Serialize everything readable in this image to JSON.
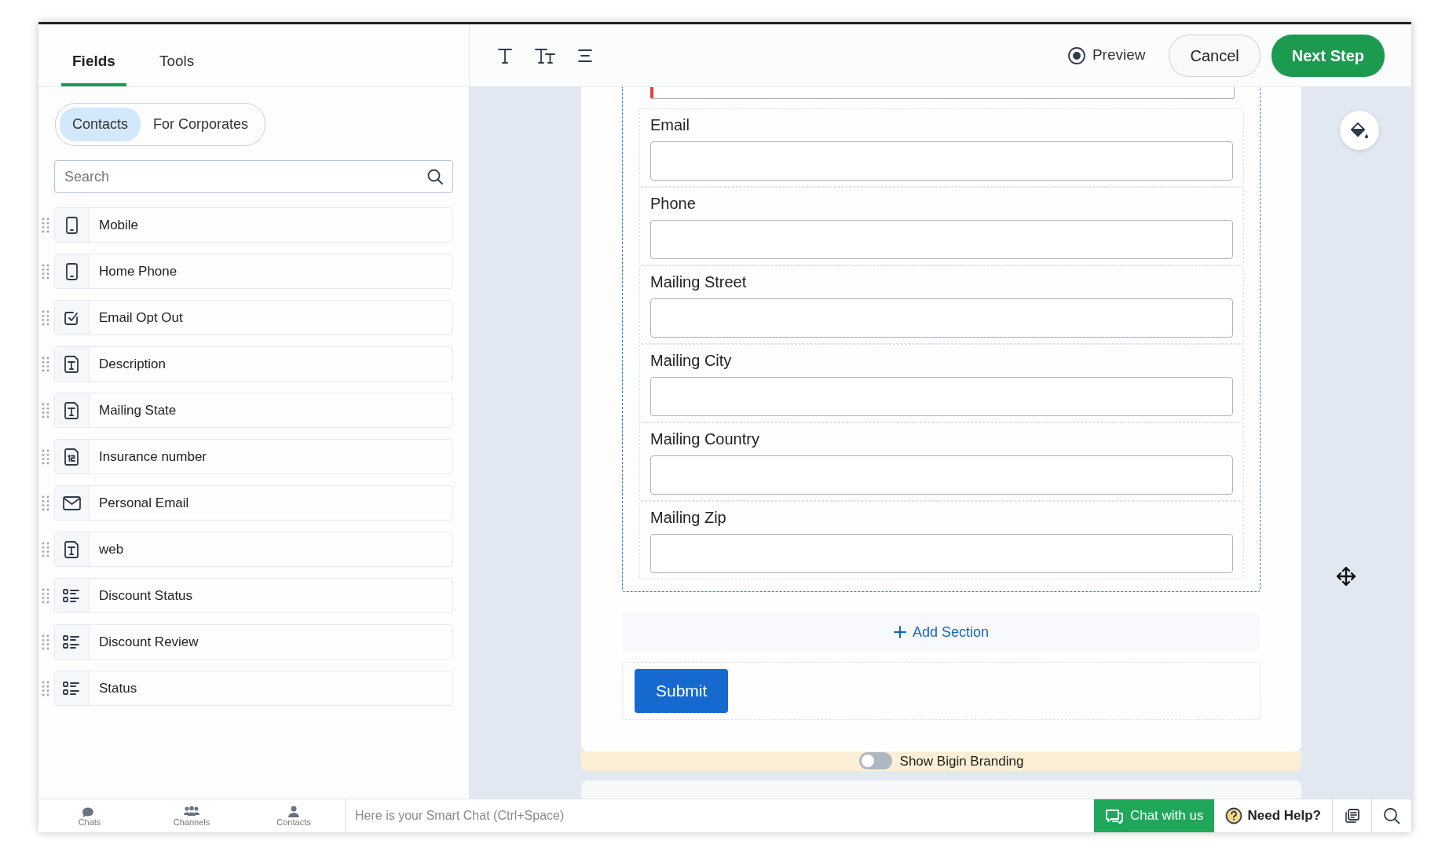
{
  "sidebar": {
    "tabs": [
      {
        "label": "Fields",
        "selected": true
      },
      {
        "label": "Tools",
        "selected": false
      }
    ],
    "segments": [
      {
        "label": "Contacts",
        "selected": true
      },
      {
        "label": "For Corporates",
        "selected": false
      }
    ],
    "search": {
      "placeholder": "Search"
    },
    "fields": [
      {
        "label": "Mobile",
        "kind": "phone"
      },
      {
        "label": "Home Phone",
        "kind": "phone"
      },
      {
        "label": "Email Opt Out",
        "kind": "checkbox"
      },
      {
        "label": "Description",
        "kind": "text"
      },
      {
        "label": "Mailing State",
        "kind": "text"
      },
      {
        "label": "Insurance number",
        "kind": "number"
      },
      {
        "label": "Personal Email",
        "kind": "email"
      },
      {
        "label": "web",
        "kind": "text"
      },
      {
        "label": "Discount Status",
        "kind": "picklist"
      },
      {
        "label": "Discount Review",
        "kind": "picklist"
      },
      {
        "label": "Status",
        "kind": "picklist"
      }
    ]
  },
  "toolbar": {
    "preview": "Preview",
    "cancel": "Cancel",
    "next": "Next Step"
  },
  "form": {
    "cut_field": {
      "error": true
    },
    "fields": [
      {
        "label": "Email"
      },
      {
        "label": "Phone"
      },
      {
        "label": "Mailing Street"
      },
      {
        "label": "Mailing City"
      },
      {
        "label": "Mailing Country"
      },
      {
        "label": "Mailing Zip"
      }
    ],
    "add_section": "Add Section",
    "submit": "Submit",
    "branding": {
      "label": "Show Bigin Branding",
      "on": false
    }
  },
  "bottom_bar": {
    "apps": [
      {
        "label": "Chats",
        "kind": "chats"
      },
      {
        "label": "Channels",
        "kind": "channels"
      },
      {
        "label": "Contacts",
        "kind": "contacts"
      }
    ],
    "smart_chat": {
      "placeholder": "Here is your Smart Chat (Ctrl+Space)"
    },
    "chat_button": "Chat with us",
    "help": "Need Help?"
  }
}
